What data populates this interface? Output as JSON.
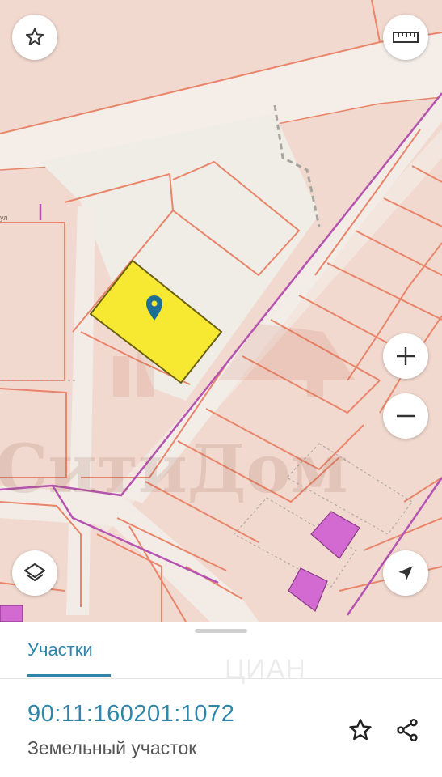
{
  "map": {
    "watermark_text": "СитиДом",
    "street_label": "ул"
  },
  "controls": {
    "favorite_icon": "star-icon",
    "ruler_icon": "ruler-icon",
    "zoom_in_icon": "plus-icon",
    "zoom_out_icon": "minus-icon",
    "layers_icon": "layers-icon",
    "locate_icon": "navigation-arrow-icon"
  },
  "sheet": {
    "tab_label": "Участки",
    "cadastral_number": "90:11:160201:1072",
    "property_type": "Земельный участок",
    "watermark_text": "ЦИАН",
    "favorite_icon": "star-outline-icon",
    "share_icon": "share-icon"
  },
  "colors": {
    "accent": "#2f86a8",
    "selected_parcel_fill": "#f7e832",
    "parcel_line": "#e8856a",
    "boundary_line": "#b553b0",
    "building_fill": "#d36ad1",
    "map_bg": "#f2d9cf",
    "road_fill": "#f3ece6"
  }
}
